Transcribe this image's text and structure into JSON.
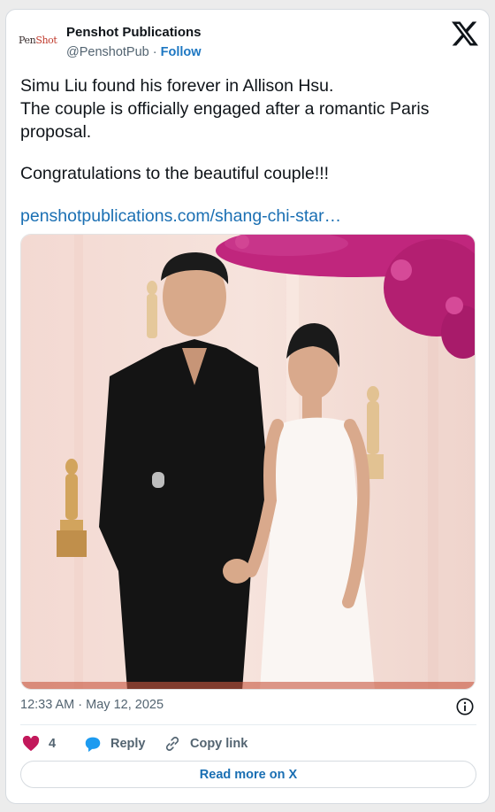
{
  "author": {
    "display_name": "Penshot Publications",
    "handle": "@PenshotPub",
    "separator": "·",
    "follow_label": "Follow",
    "avatar_text_a": "Pen",
    "avatar_text_b": "Shot"
  },
  "brand_icon": "x-logo-icon",
  "tweet": {
    "line1": "Simu Liu found his forever in Allison Hsu.",
    "line2": "The couple is officially engaged after a romantic Paris proposal.",
    "line3": "Congratulations to the beautiful couple!!!",
    "link": "penshotpublications.com/shang-chi-star…"
  },
  "media": {
    "alt_subject": "photo-couple-red-carpet"
  },
  "meta": {
    "timestamp": "12:33 AM · May 12, 2025"
  },
  "actions": {
    "like_count": "4",
    "reply_label": "Reply",
    "copy_label": "Copy link"
  },
  "read_more_label": "Read more on X",
  "colors": {
    "accent": "#1a6fb3",
    "like": "#c2185b",
    "reply": "#1d9bf0",
    "muted": "#536471"
  }
}
